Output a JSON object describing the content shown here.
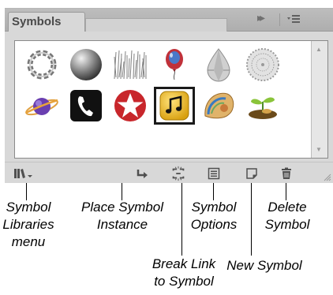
{
  "panel": {
    "tab_label": "Symbols",
    "expand_glyph": "▸▸",
    "menu_glyph": "panel-menu-icon"
  },
  "symbols": [
    {
      "name": "twisted-ribbon-ring",
      "selected": false
    },
    {
      "name": "gray-sphere",
      "selected": false
    },
    {
      "name": "grass-texture",
      "selected": false
    },
    {
      "name": "balloon",
      "selected": false
    },
    {
      "name": "teardrop-gem",
      "selected": false
    },
    {
      "name": "lace-circle",
      "selected": false
    },
    {
      "name": "ringed-planet",
      "selected": false
    },
    {
      "name": "telephone",
      "selected": false
    },
    {
      "name": "red-star-circle",
      "selected": false
    },
    {
      "name": "music-note",
      "selected": true
    },
    {
      "name": "nautilus-shell",
      "selected": false
    },
    {
      "name": "seedling-plant",
      "selected": false
    }
  ],
  "toolbar": {
    "icons": [
      "symbol-libraries-menu-icon",
      "place-symbol-instance-icon",
      "break-link-icon",
      "symbol-options-icon",
      "new-symbol-icon",
      "delete-symbol-icon"
    ]
  },
  "callouts": {
    "symbol_libraries_menu": "Symbol\nLibraries\nmenu",
    "place_symbol_instance": "Place Symbol\nInstance",
    "break_link": "Break Link\nto Symbol",
    "symbol_options": "Symbol\nOptions",
    "new_symbol": "New Symbol",
    "delete_symbol": "Delete\nSymbol"
  }
}
